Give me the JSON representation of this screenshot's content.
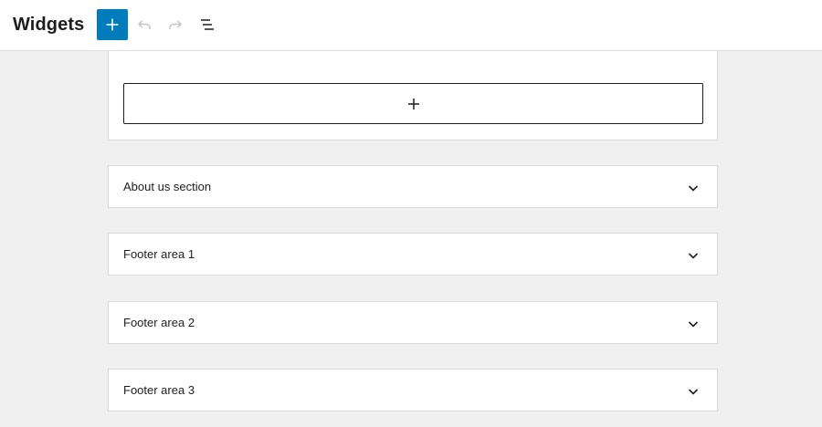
{
  "header": {
    "title": "Widgets",
    "buttons": {
      "add": "block-inserter-plus-icon",
      "undo": "undo-icon",
      "redo": "redo-icon",
      "list_view": "list-view-icon"
    }
  },
  "colors": {
    "accent": "#007cba",
    "background": "#f0f0f0",
    "panel": "#ffffff"
  },
  "widget_areas": [
    {
      "label": "About us section",
      "expanded": false
    },
    {
      "label": "Footer area 1",
      "expanded": false
    },
    {
      "label": "Footer area 2",
      "expanded": false
    },
    {
      "label": "Footer area 3",
      "expanded": false
    }
  ]
}
